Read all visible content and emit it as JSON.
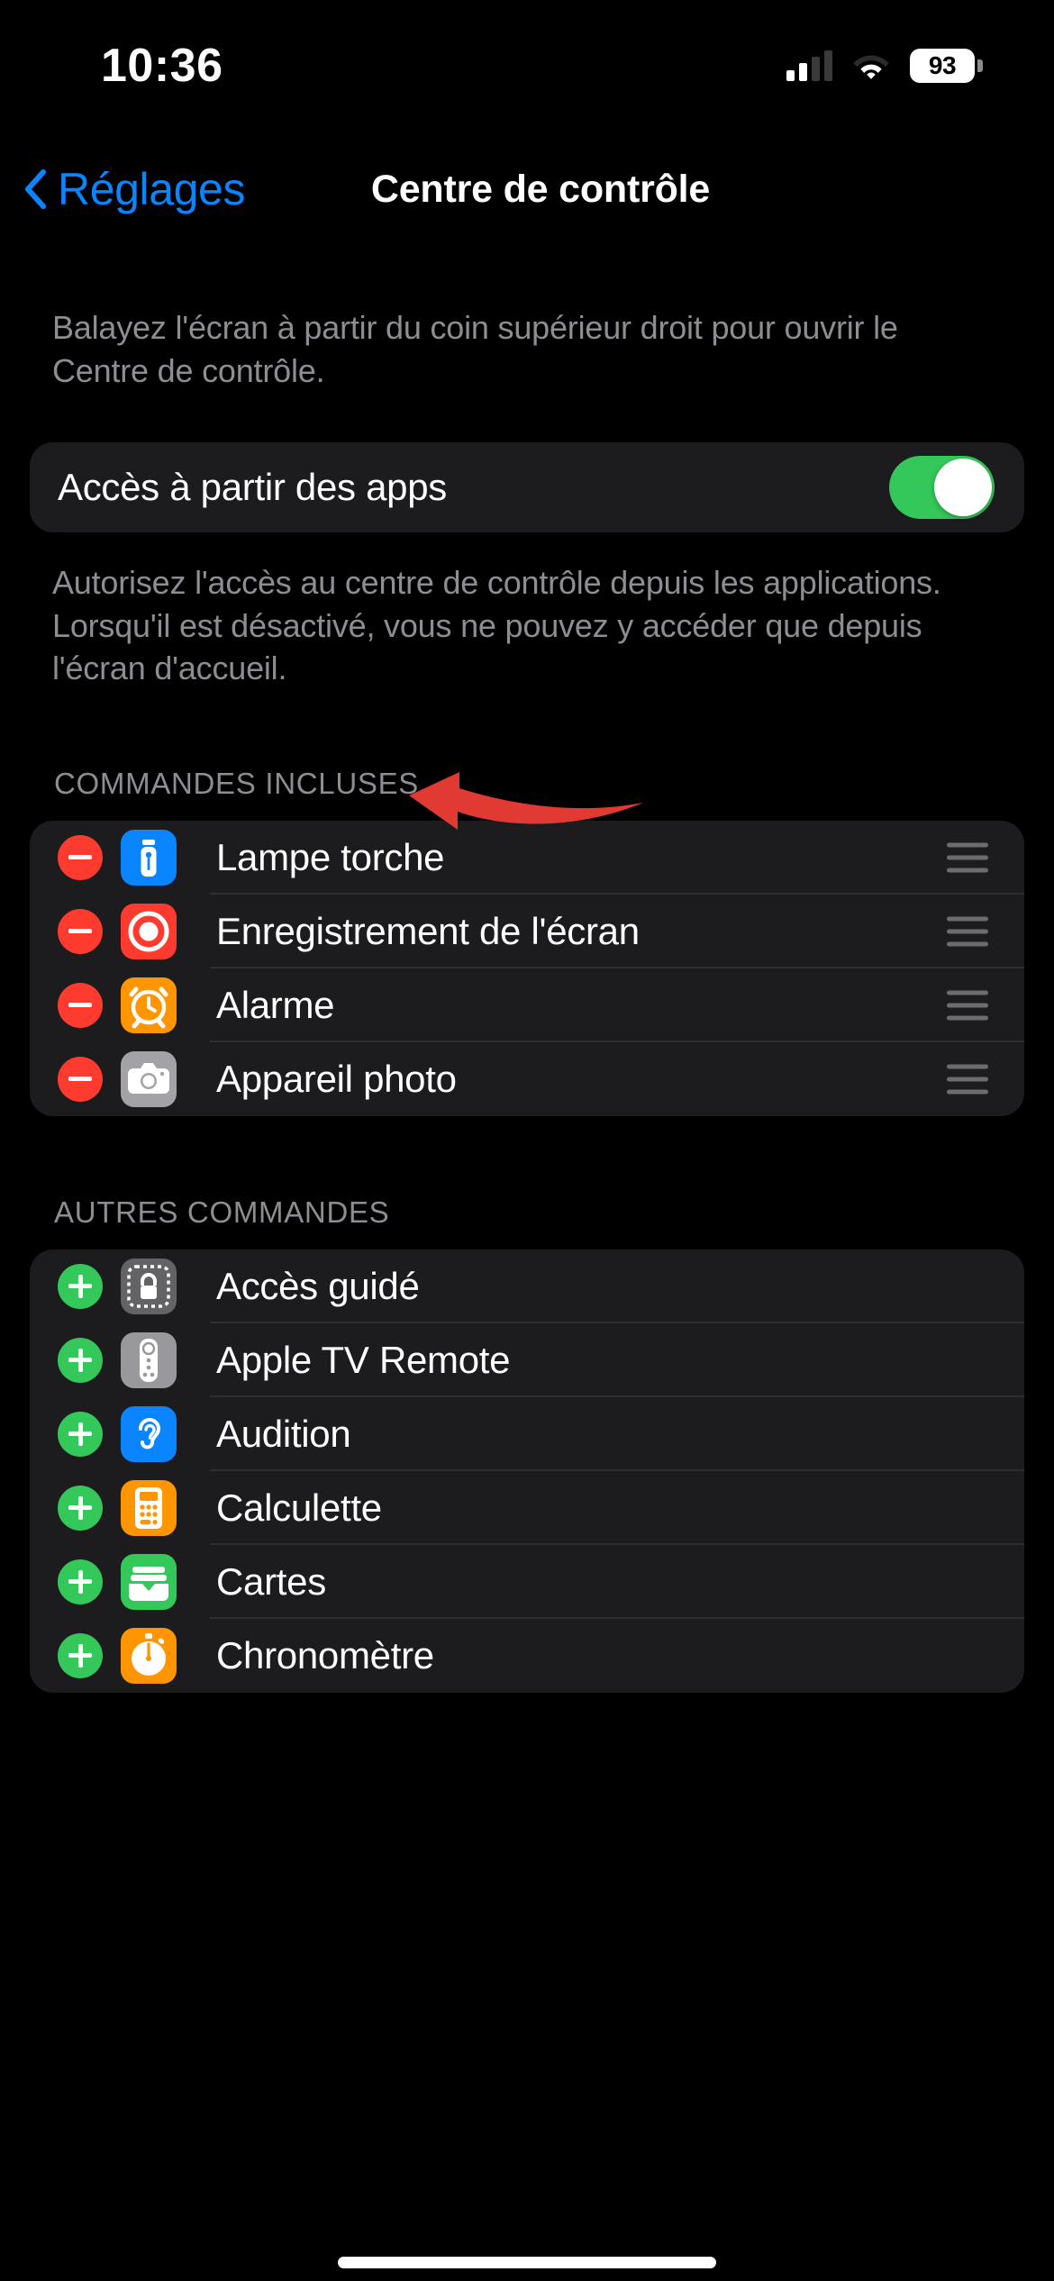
{
  "status_bar": {
    "time": "10:36",
    "battery_percent": "93",
    "cellular_icon": "cellular-signal-icon",
    "wifi_icon": "wifi-icon",
    "battery_icon": "battery-icon"
  },
  "nav": {
    "back_label": "Réglages",
    "back_icon": "chevron-left-icon",
    "title": "Centre de contrôle"
  },
  "intro_footnote": "Balayez l'écran à partir du coin supérieur droit pour ouvrir le Centre de contrôle.",
  "access_row": {
    "label": "Accès à partir des apps",
    "toggle_on": true,
    "toggle_color": "#34C759"
  },
  "access_footnote": "Autorisez l'accès au centre de contrôle depuis les applications. Lorsqu'il est désactivé, vous ne pouvez y accéder que depuis l'écran d'accueil.",
  "included_section": {
    "header": "COMMANDES INCLUSES",
    "items": [
      {
        "label": "Lampe torche",
        "icon": "flashlight-icon",
        "icon_bg": "#0A84FF",
        "action": "remove"
      },
      {
        "label": "Enregistrement de l'écran",
        "icon": "screen-record-icon",
        "icon_bg": "#FF3B30",
        "action": "remove"
      },
      {
        "label": "Alarme",
        "icon": "alarm-clock-icon",
        "icon_bg": "#FF9500",
        "action": "remove"
      },
      {
        "label": "Appareil photo",
        "icon": "camera-icon",
        "icon_bg": "#A2A2A7",
        "action": "remove"
      }
    ]
  },
  "other_section": {
    "header": "AUTRES COMMANDES",
    "items": [
      {
        "label": "Accès guidé",
        "icon": "guided-access-lock-icon",
        "icon_bg": "#636366",
        "action": "add"
      },
      {
        "label": "Apple TV Remote",
        "icon": "tv-remote-icon",
        "icon_bg": "#98989D",
        "action": "add"
      },
      {
        "label": "Audition",
        "icon": "hearing-ear-icon",
        "icon_bg": "#0A84FF",
        "action": "add"
      },
      {
        "label": "Calculette",
        "icon": "calculator-icon",
        "icon_bg": "#FF9500",
        "action": "add"
      },
      {
        "label": "Cartes",
        "icon": "wallet-cards-icon",
        "icon_bg": "#34C759",
        "action": "add"
      },
      {
        "label": "Chronomètre",
        "icon": "stopwatch-icon",
        "icon_bg": "#FF9500",
        "action": "add"
      }
    ]
  },
  "annotation": {
    "type": "arrow",
    "color": "#E03A32",
    "points_to": "Alarme"
  }
}
